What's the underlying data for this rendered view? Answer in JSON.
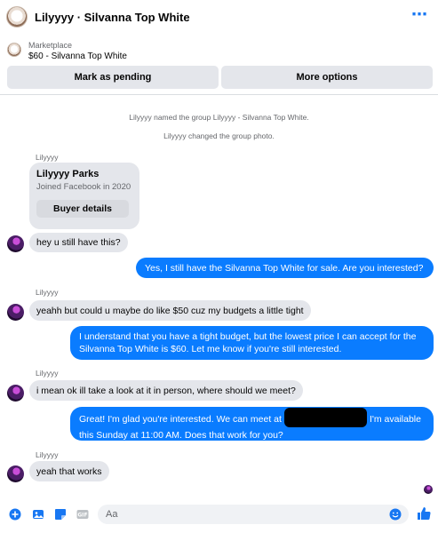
{
  "header": {
    "title": "Lilyyyy · Silvanna Top White"
  },
  "marketplace": {
    "label": "Marketplace",
    "item": "$60 - Silvanna Top White"
  },
  "actions": {
    "pending": "Mark as pending",
    "more": "More options"
  },
  "system_messages": [
    "Lilyyyy named the group Lilyyyy - Silvanna Top White.",
    "Lilyyyy changed the group photo."
  ],
  "sender_name": "Lilyyyy",
  "profile_card": {
    "name": "Lilyyyy Parks",
    "joined": "Joined Facebook in 2020",
    "button": "Buyer details"
  },
  "messages": [
    {
      "from": "them",
      "text": "hey u still have this?"
    },
    {
      "from": "me",
      "text": "Yes, I still have the Silvanna Top White for sale. Are you interested?"
    },
    {
      "from": "them",
      "text": "yeahh but could u maybe do like $50 cuz my budgets a little tight"
    },
    {
      "from": "me",
      "text": "I understand that you have a tight budget, but the lowest price I can accept for the Silvanna Top White is $60. Let me know if you're still interested."
    },
    {
      "from": "them",
      "text": "i mean ok ill take a look at it in person, where should we meet?"
    },
    {
      "from": "me",
      "text_a": "Great! I'm glad you're interested. We can meet at",
      "text_b": "I'm available this Sunday at 11:00 AM. Does that work for you?"
    },
    {
      "from": "them",
      "text": "yeah that works"
    }
  ],
  "composer": {
    "placeholder": "Aa"
  },
  "colors": {
    "accent": "#0a7cff",
    "incoming": "#e4e6eb",
    "link": "#1877f2"
  }
}
